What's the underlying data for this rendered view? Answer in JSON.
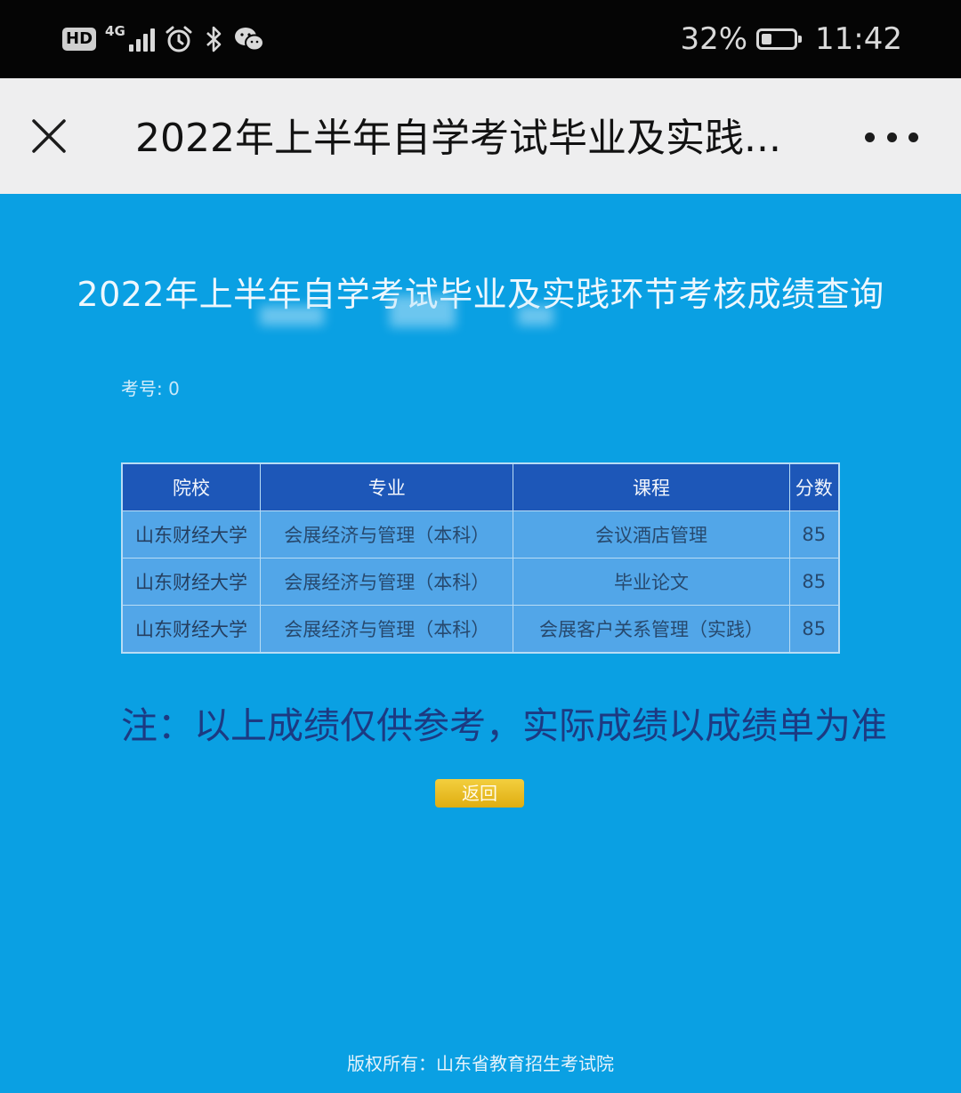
{
  "status_bar": {
    "hd_label": "HD",
    "network": "4G",
    "signal_bars": 4,
    "battery_percent": "32%",
    "battery_level": 0.32,
    "time": "11:42",
    "icons": [
      "hd-icon",
      "signal-icon",
      "alarm-icon",
      "bluetooth-icon",
      "wechat-icon",
      "battery-icon"
    ]
  },
  "title_bar": {
    "title": "2022年上半年自学考试毕业及实践...",
    "close_icon": "close-icon",
    "more_icon": "more-icon"
  },
  "page": {
    "heading": "2022年上半年自学考试毕业及实践环节考核成绩查询",
    "exam_number_label": "考号:",
    "exam_number_value": "0",
    "table": {
      "headers": [
        "院校",
        "专业",
        "课程",
        "分数"
      ],
      "rows": [
        [
          "山东财经大学",
          "会展经济与管理（本科）",
          "会议酒店管理",
          "85"
        ],
        [
          "山东财经大学",
          "会展经济与管理（本科）",
          "毕业论文",
          "85"
        ],
        [
          "山东财经大学",
          "会展经济与管理（本科）",
          "会展客户关系管理（实践）",
          "85"
        ]
      ]
    },
    "note": "注：以上成绩仅供参考，实际成绩以成绩单为准",
    "back_button": "返回",
    "footer": "版权所有：山东省教育招生考试院"
  },
  "colors": {
    "background": "#0aa0e3",
    "table_header": "#1d57b8",
    "table_cell": "#52a6e8",
    "note_text": "#1c3a82",
    "button": "#e8bb22"
  }
}
